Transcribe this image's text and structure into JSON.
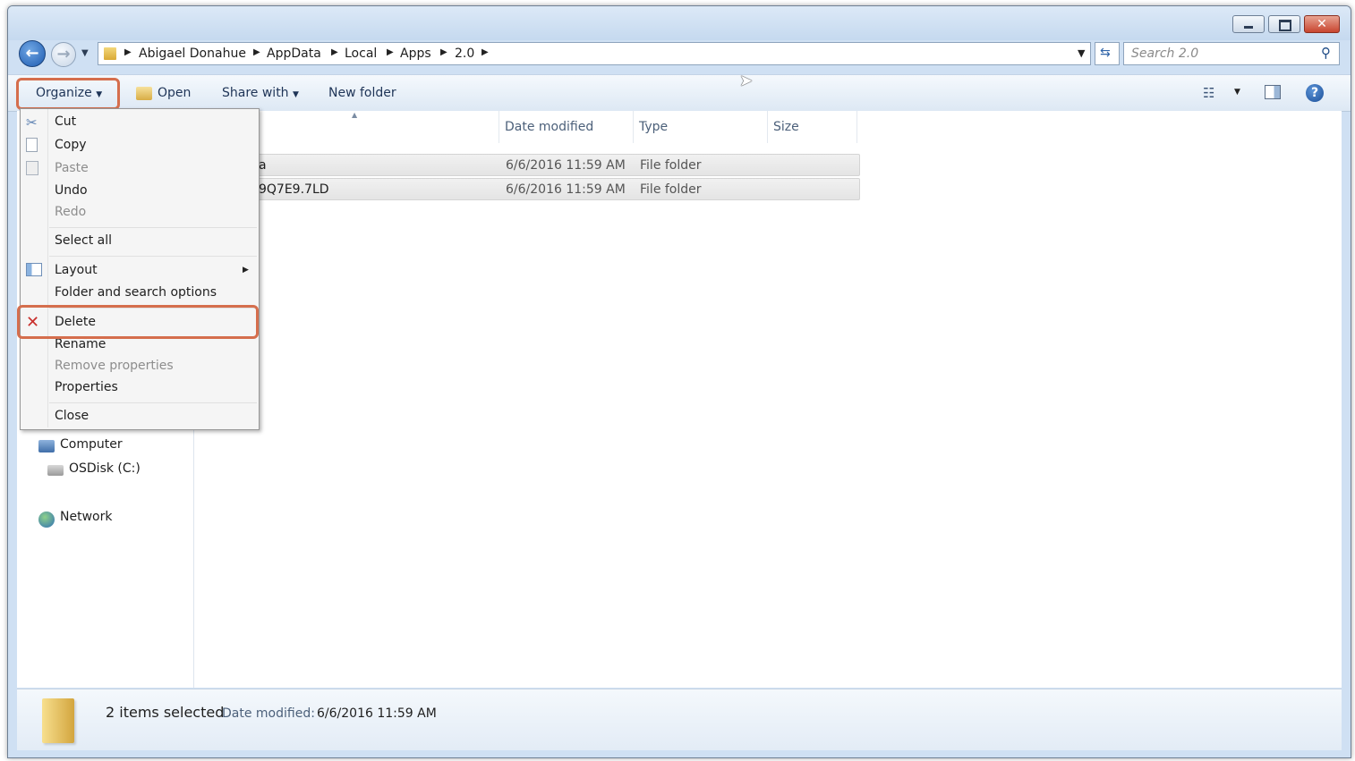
{
  "breadcrumbs": [
    "Abigael Donahue",
    "AppData",
    "Local",
    "Apps",
    "2.0"
  ],
  "search": {
    "placeholder": "Search 2.0"
  },
  "toolbar": {
    "organize": "Organize",
    "open": "Open",
    "share_with": "Share with",
    "new_folder": "New folder"
  },
  "columns": {
    "name": "",
    "date_modified": "Date modified",
    "type": "Type",
    "size": "Size"
  },
  "rows": [
    {
      "name": "a",
      "date": "6/6/2016 11:59 AM",
      "type": "File folder"
    },
    {
      "name": "9Q7E9.7LD",
      "date": "6/6/2016 11:59 AM",
      "type": "File folder"
    }
  ],
  "nav_tree": {
    "computer": "Computer",
    "osdisk": "OSDisk (C:)",
    "network": "Network"
  },
  "menu": {
    "cut": "Cut",
    "copy": "Copy",
    "paste": "Paste",
    "undo": "Undo",
    "redo": "Redo",
    "select_all": "Select all",
    "layout": "Layout",
    "folder_options": "Folder and search options",
    "delete": "Delete",
    "rename": "Rename",
    "remove_properties": "Remove properties",
    "properties": "Properties",
    "close": "Close"
  },
  "details": {
    "selected": "2 items selected",
    "date_label": "Date modified:",
    "date_value": "6/6/2016 11:59 AM"
  },
  "colors": {
    "highlight": "#d56e4d",
    "frame": "#cfe0f3"
  }
}
